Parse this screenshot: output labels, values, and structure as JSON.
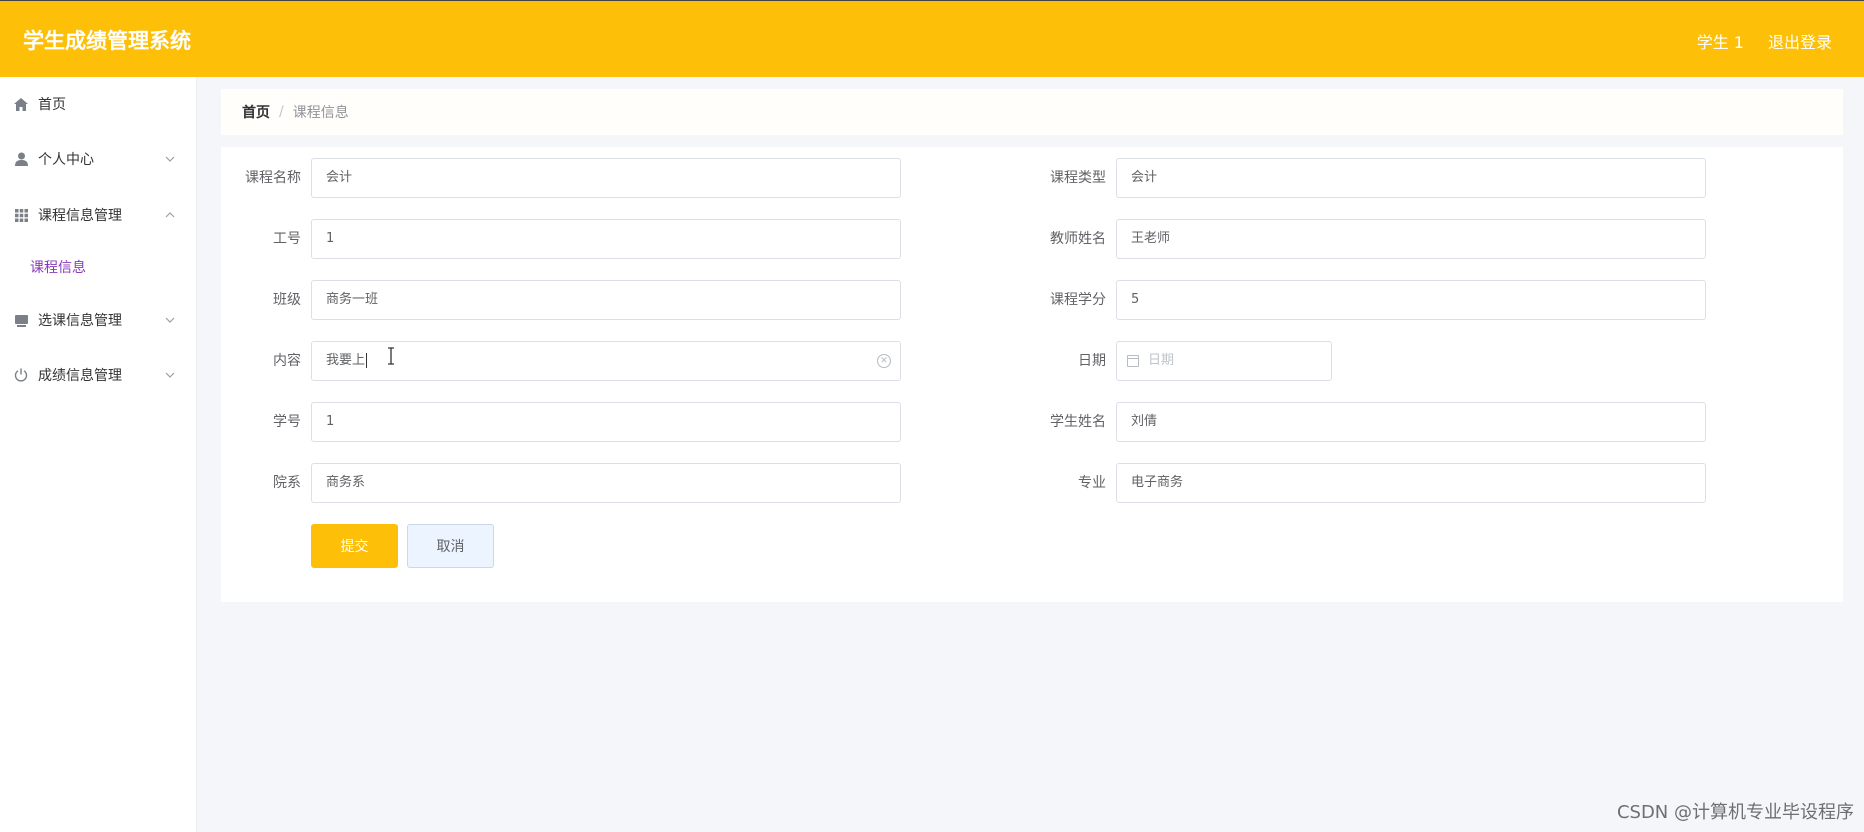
{
  "header": {
    "title": "学生成绩管理系统",
    "user": "学生 1",
    "logout": "退出登录",
    "bg_color": "#fdbf08"
  },
  "sidebar": {
    "items": [
      {
        "label": "首页",
        "icon": "home-icon"
      },
      {
        "label": "个人中心",
        "icon": "user-icon",
        "expanded": false
      },
      {
        "label": "课程信息管理",
        "icon": "grid-icon",
        "expanded": true,
        "children": [
          {
            "label": "课程信息",
            "active": true
          }
        ]
      },
      {
        "label": "选课信息管理",
        "icon": "book-icon",
        "expanded": false
      },
      {
        "label": "成绩信息管理",
        "icon": "power-icon",
        "expanded": false
      }
    ],
    "active_color": "#8a3ab9"
  },
  "breadcrumb": {
    "home": "首页",
    "separator": "/",
    "current": "课程信息"
  },
  "form": {
    "fields": {
      "course_name": {
        "label": "课程名称",
        "value": "会计"
      },
      "course_type": {
        "label": "课程类型",
        "value": "会计"
      },
      "staff_id": {
        "label": "工号",
        "value": "1"
      },
      "teacher_name": {
        "label": "教师姓名",
        "value": "王老师"
      },
      "class": {
        "label": "班级",
        "value": "商务一班"
      },
      "credit": {
        "label": "课程学分",
        "value": "5"
      },
      "content": {
        "label": "内容",
        "value": "我要上"
      },
      "date": {
        "label": "日期",
        "placeholder": "日期"
      },
      "student_id": {
        "label": "学号",
        "value": "1"
      },
      "student_name": {
        "label": "学生姓名",
        "value": "刘倩"
      },
      "department": {
        "label": "院系",
        "value": "商务系"
      },
      "major": {
        "label": "专业",
        "value": "电子商务"
      }
    },
    "submit": "提交",
    "cancel": "取消"
  },
  "watermark": "CSDN @计算机专业毕设程序"
}
